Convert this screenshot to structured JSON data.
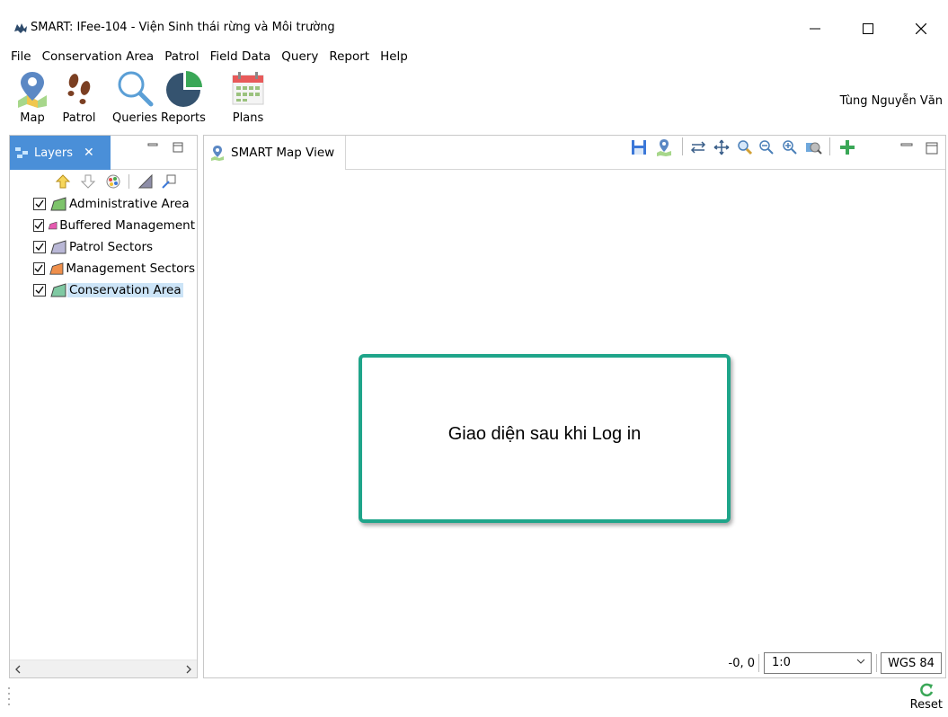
{
  "window": {
    "title": "SMART: IFee-104 - Viện Sinh thái rừng và Môi trường",
    "minimize_glyph": "—",
    "maximize_glyph": "☐",
    "close_glyph": "✕"
  },
  "menu": [
    "File",
    "Conservation Area",
    "Patrol",
    "Field Data",
    "Query",
    "Report",
    "Help"
  ],
  "toolbar": {
    "items": [
      {
        "label": "Map",
        "icon": "map-pin-icon"
      },
      {
        "label": "Patrol",
        "icon": "footprints-icon"
      },
      {
        "label": "Queries",
        "icon": "magnifier-icon"
      },
      {
        "label": "Reports",
        "icon": "pie-chart-icon"
      },
      {
        "label": "Plans",
        "icon": "calendar-icon"
      }
    ],
    "user_name": "Tùng Nguyễn Văn"
  },
  "layers_panel": {
    "tab_label": "Layers",
    "layers": [
      {
        "name": "Administrative Area",
        "color": "#7dc36b",
        "checked": true
      },
      {
        "name": "Buffered Management",
        "color": "#e65ab0",
        "checked": true
      },
      {
        "name": "Patrol Sectors",
        "color": "#b9b7d6",
        "checked": true
      },
      {
        "name": "Management Sectors",
        "color": "#ef8f4b",
        "checked": true
      },
      {
        "name": "Conservation Area",
        "color": "#7fc9a2",
        "checked": true,
        "selected": true
      }
    ]
  },
  "map_view": {
    "tab_label": "SMART Map View",
    "callout_text": "Giao diện sau khi Log in",
    "coords": "-0, 0",
    "scale": "1:0",
    "crs": "WGS 84"
  },
  "status": {
    "reset_label": "Reset"
  },
  "colors": {
    "tab_active": "#4a8fd8",
    "callout_border": "#1fa58a",
    "selection": "#cce4f7"
  }
}
